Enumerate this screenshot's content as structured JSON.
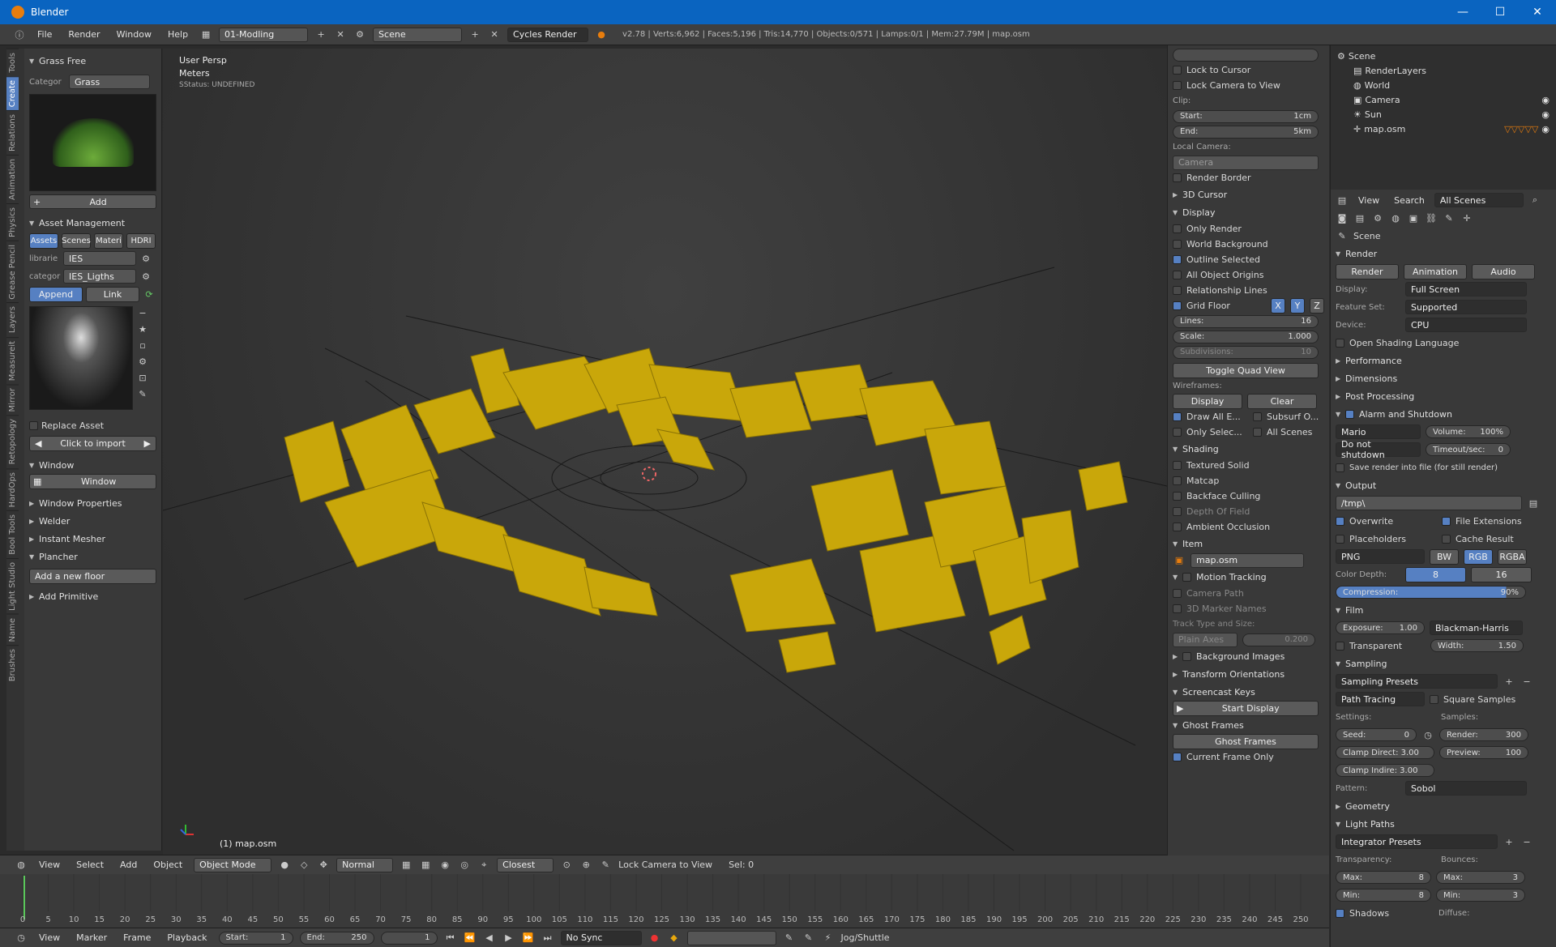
{
  "titlebar": {
    "title": "Blender",
    "min": "—",
    "max": "☐",
    "close": "✕"
  },
  "topbar": {
    "menus": [
      "File",
      "Render",
      "Window",
      "Help"
    ],
    "screen_layout": "01-Modling",
    "scene": "Scene",
    "engine": "Cycles Render",
    "stats": "v2.78 | Verts:6,962 | Faces:5,196 | Tris:14,770 | Objects:0/571 | Lamps:0/1 | Mem:27.79M | map.osm"
  },
  "vtabs": [
    "Tools",
    "Create",
    "Relations",
    "Animation",
    "Physics",
    "Grease Pencil",
    "Layers",
    "Measureit",
    "Mirror",
    "Retopology",
    "HardOps",
    "Bool Tools",
    "Light Studio",
    "Name",
    "Brushes"
  ],
  "toolshelf": {
    "grass_panel": "Grass Free",
    "categ_label": "Categor",
    "categ_value": "Grass",
    "add_btn": "Add",
    "asset_panel": "Asset Management",
    "asset_tabs": [
      "Assets",
      "Scenes",
      "Materi",
      "HDRI"
    ],
    "librarie_label": "librarie",
    "librarie_value": "IES",
    "category_label": "categor",
    "category_value": "IES_Ligths",
    "append": "Append",
    "link": "Link",
    "replace_asset": "Replace Asset",
    "click_import": "Click to import",
    "window_panel": "Window",
    "window_btn": "Window",
    "window_props": "Window Properties",
    "welder": "Welder",
    "instant_mesher": "Instant Mesher",
    "plancher": "Plancher",
    "add_floor": "Add a new floor",
    "add_primitive": "Add Primitive"
  },
  "viewport": {
    "view_name": "User Persp",
    "units": "Meters",
    "status": "SStatus: UNDEFINED",
    "object_label": "(1) map.osm"
  },
  "vp_header": {
    "view": "View",
    "select": "Select",
    "add": "Add",
    "object": "Object",
    "mode": "Object Mode",
    "pivot": "Normal",
    "snap": "Closest",
    "lock_cam": "Lock Camera to View",
    "sel": "Sel: 0"
  },
  "npanel": {
    "lock_cursor": "Lock to Cursor",
    "lock_camera": "Lock Camera to View",
    "clip": "Clip:",
    "start_label": "Start:",
    "start_val": "1cm",
    "end_label": "End:",
    "end_val": "5km",
    "local_camera": "Local Camera:",
    "camera": "Camera",
    "render_border": "Render Border",
    "cursor3d": "3D Cursor",
    "display": "Display",
    "only_render": "Only Render",
    "world_bg": "World Background",
    "outline_sel": "Outline Selected",
    "all_origins": "All Object Origins",
    "rel_lines": "Relationship Lines",
    "grid_floor": "Grid Floor",
    "axes": [
      "X",
      "Y",
      "Z"
    ],
    "lines_label": "Lines:",
    "lines_val": "16",
    "scale_label": "Scale:",
    "scale_val": "1.000",
    "subdiv_label": "Subdivisions:",
    "subdiv_val": "10",
    "toggle_quad": "Toggle Quad View",
    "wireframes": "Wireframes:",
    "wf_display": "Display",
    "wf_clear": "Clear",
    "draw_all": "Draw All E...",
    "subsurf": "Subsurf O...",
    "only_selec": "Only Selec...",
    "all_scenes": "All Scenes",
    "shading": "Shading",
    "textured_solid": "Textured Solid",
    "matcap": "Matcap",
    "backface": "Backface Culling",
    "dof": "Depth Of Field",
    "ao": "Ambient Occlusion",
    "item": "Item",
    "item_name": "map.osm",
    "motion": "Motion Tracking",
    "cam_path": "Camera Path",
    "marker_names": "3D Marker Names",
    "track_type": "Track Type and Size:",
    "plain_axes": "Plain Axes",
    "plain_val": "0.200",
    "bg_images": "Background Images",
    "transform_orient": "Transform Orientations",
    "screencast": "Screencast Keys",
    "start_display": "Start Display",
    "ghost_frames": "Ghost Frames",
    "ghost_btn": "Ghost Frames",
    "current_frame": "Current Frame Only"
  },
  "outliner": {
    "items": [
      {
        "label": "Scene",
        "indent": 0
      },
      {
        "label": "RenderLayers",
        "indent": 1
      },
      {
        "label": "World",
        "indent": 1
      },
      {
        "label": "Camera",
        "indent": 1
      },
      {
        "label": "Sun",
        "indent": 1
      },
      {
        "label": "map.osm",
        "indent": 1
      }
    ]
  },
  "props": {
    "hdr": {
      "view": "View",
      "search": "Search",
      "all_scenes": "All Scenes"
    },
    "scene": "Scene",
    "render": "Render",
    "render_btn": "Render",
    "anim_btn": "Animation",
    "audio_btn": "Audio",
    "display_label": "Display:",
    "display_val": "Full Screen",
    "feature_label": "Feature Set:",
    "feature_val": "Supported",
    "device_label": "Device:",
    "device_val": "CPU",
    "osl": "Open Shading Language",
    "performance": "Performance",
    "dimensions": "Dimensions",
    "post": "Post Processing",
    "alarm": "Alarm and Shutdown",
    "mario": "Mario",
    "volume_label": "Volume:",
    "volume_val": "100%",
    "shutdown": "Do not shutdown",
    "timeout_label": "Timeout/sec:",
    "timeout_val": "0",
    "save_render": "Save render into file (for still render)",
    "output": "Output",
    "path": "/tmp\\",
    "overwrite": "Overwrite",
    "file_ext": "File Extensions",
    "placeholders": "Placeholders",
    "cache": "Cache Result",
    "format": "PNG",
    "bw": "BW",
    "rgb": "RGB",
    "rgba": "RGBA",
    "color_depth": "Color Depth:",
    "depth8": "8",
    "depth16": "16",
    "compression": "Compression:",
    "compression_val": "90%",
    "film": "Film",
    "exposure_label": "Exposure:",
    "exposure_val": "1.00",
    "filter": "Blackman-Harris",
    "transparent": "Transparent",
    "width_label": "Width:",
    "width_val": "1.50",
    "sampling": "Sampling",
    "sampling_presets": "Sampling Presets",
    "path_tracing": "Path Tracing",
    "square_samples": "Square Samples",
    "settings": "Settings:",
    "samples": "Samples:",
    "seed_label": "Seed:",
    "seed_val": "0",
    "render_label": "Render:",
    "render_val": "300",
    "clamp_direct": "Clamp Direct: 3.00",
    "preview_label": "Preview:",
    "preview_val": "100",
    "clamp_indirect": "Clamp Indire: 3.00",
    "pattern_label": "Pattern:",
    "pattern_val": "Sobol",
    "geometry": "Geometry",
    "light_paths": "Light Paths",
    "integrator": "Integrator Presets",
    "transparency": "Transparency:",
    "bounces": "Bounces:",
    "max_label": "Max:",
    "max_t": "8",
    "min_label": "Min:",
    "min_t": "8",
    "max_b": "3",
    "min_b": "3",
    "shadows": "Shadows",
    "diffuse": "Diffuse:"
  },
  "timeline": {
    "ticks": [
      "0",
      "5",
      "10",
      "15",
      "20",
      "25",
      "30",
      "35",
      "40",
      "45",
      "50",
      "55",
      "60",
      "65",
      "70",
      "75",
      "80",
      "85",
      "90",
      "95",
      "100",
      "105",
      "110",
      "115",
      "120",
      "125",
      "130",
      "135",
      "140",
      "145",
      "150",
      "155",
      "160",
      "165",
      "170",
      "175",
      "180",
      "185",
      "190",
      "195",
      "200",
      "205",
      "210",
      "215",
      "220",
      "225",
      "230",
      "235",
      "240",
      "245",
      "250"
    ]
  },
  "tl_header": {
    "view": "View",
    "marker": "Marker",
    "frame": "Frame",
    "playback": "Playback",
    "start_label": "Start:",
    "start_val": "1",
    "end_label": "End:",
    "end_val": "250",
    "cur": "1",
    "sync": "No Sync",
    "jog": "Jog/Shuttle"
  }
}
